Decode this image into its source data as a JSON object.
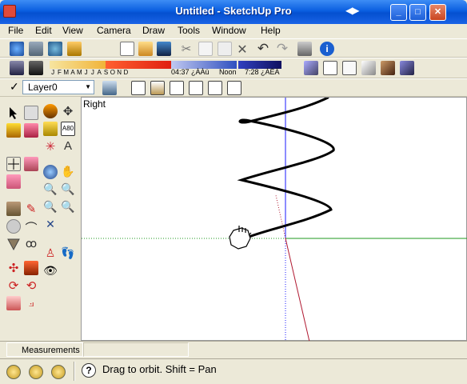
{
  "window": {
    "title": "Untitled - SketchUp Pro"
  },
  "menu": [
    "File",
    "Edit",
    "View",
    "Camera",
    "Draw",
    "Tools",
    "Window",
    "Help"
  ],
  "shadows": {
    "months": [
      "J",
      "F",
      "M",
      "A",
      "M",
      "J",
      "J",
      "A",
      "S",
      "O",
      "N",
      "D"
    ],
    "time_start": "04:37 ¿ÀÀü",
    "time_noon": "Noon",
    "time_end": "7:28 ¿ÀÈÄ"
  },
  "layers": {
    "current": "Layer0"
  },
  "viewport": {
    "view_name": "Right"
  },
  "measurements": {
    "label": "Measurements",
    "value": ""
  },
  "status": {
    "message": "Drag to orbit.  Shift = Pan"
  },
  "colors": {
    "axis_blue": "#1a1aff",
    "axis_green": "#1f9a1f",
    "axis_red": "#b01830",
    "titlebar": "#0a5ee0"
  }
}
